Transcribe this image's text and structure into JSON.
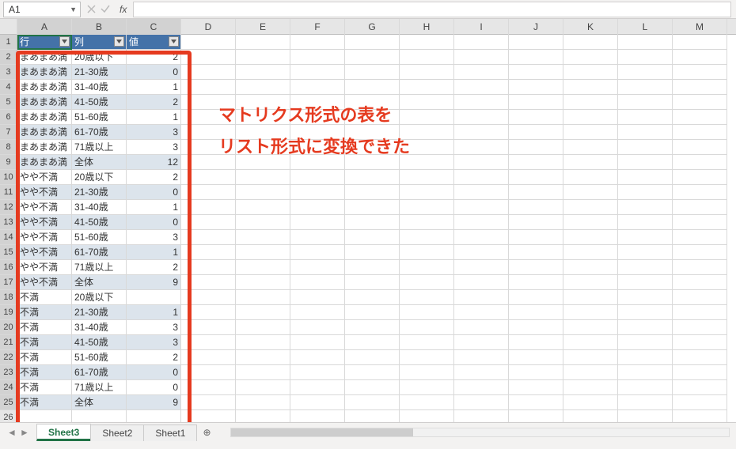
{
  "namebox": {
    "value": "A1"
  },
  "columns": [
    "",
    "A",
    "B",
    "C",
    "D",
    "E",
    "F",
    "G",
    "H",
    "I",
    "J",
    "K",
    "L",
    "M"
  ],
  "table": {
    "headers": [
      "行",
      "列",
      "値"
    ],
    "rows": [
      {
        "r": "まあまあ満",
        "c": "20歳以下",
        "v": "2"
      },
      {
        "r": "まあまあ満",
        "c": "21-30歳",
        "v": "0"
      },
      {
        "r": "まあまあ満",
        "c": "31-40歳",
        "v": "1"
      },
      {
        "r": "まあまあ満",
        "c": "41-50歳",
        "v": "2"
      },
      {
        "r": "まあまあ満",
        "c": "51-60歳",
        "v": "1"
      },
      {
        "r": "まあまあ満",
        "c": "61-70歳",
        "v": "3"
      },
      {
        "r": "まあまあ満",
        "c": "71歳以上",
        "v": "3"
      },
      {
        "r": "まあまあ満",
        "c": "全体",
        "v": "12"
      },
      {
        "r": "やや不満",
        "c": "20歳以下",
        "v": "2"
      },
      {
        "r": "やや不満",
        "c": "21-30歳",
        "v": "0"
      },
      {
        "r": "やや不満",
        "c": "31-40歳",
        "v": "1"
      },
      {
        "r": "やや不満",
        "c": "41-50歳",
        "v": "0"
      },
      {
        "r": "やや不満",
        "c": "51-60歳",
        "v": "3"
      },
      {
        "r": "やや不満",
        "c": "61-70歳",
        "v": "1"
      },
      {
        "r": "やや不満",
        "c": "71歳以上",
        "v": "2"
      },
      {
        "r": "やや不満",
        "c": "全体",
        "v": "9"
      },
      {
        "r": "不満",
        "c": "20歳以下",
        "v": ""
      },
      {
        "r": "不満",
        "c": "21-30歳",
        "v": "1"
      },
      {
        "r": "不満",
        "c": "31-40歳",
        "v": "3"
      },
      {
        "r": "不満",
        "c": "41-50歳",
        "v": "3"
      },
      {
        "r": "不満",
        "c": "51-60歳",
        "v": "2"
      },
      {
        "r": "不満",
        "c": "61-70歳",
        "v": "0"
      },
      {
        "r": "不満",
        "c": "71歳以上",
        "v": "0"
      },
      {
        "r": "不満",
        "c": "全体",
        "v": "9"
      }
    ]
  },
  "annotation": {
    "line1": "マトリクス形式の表を",
    "line2": "リスト形式に変換できた"
  },
  "tabs": [
    "Sheet3",
    "Sheet2",
    "Sheet1"
  ],
  "active_tab": 0
}
